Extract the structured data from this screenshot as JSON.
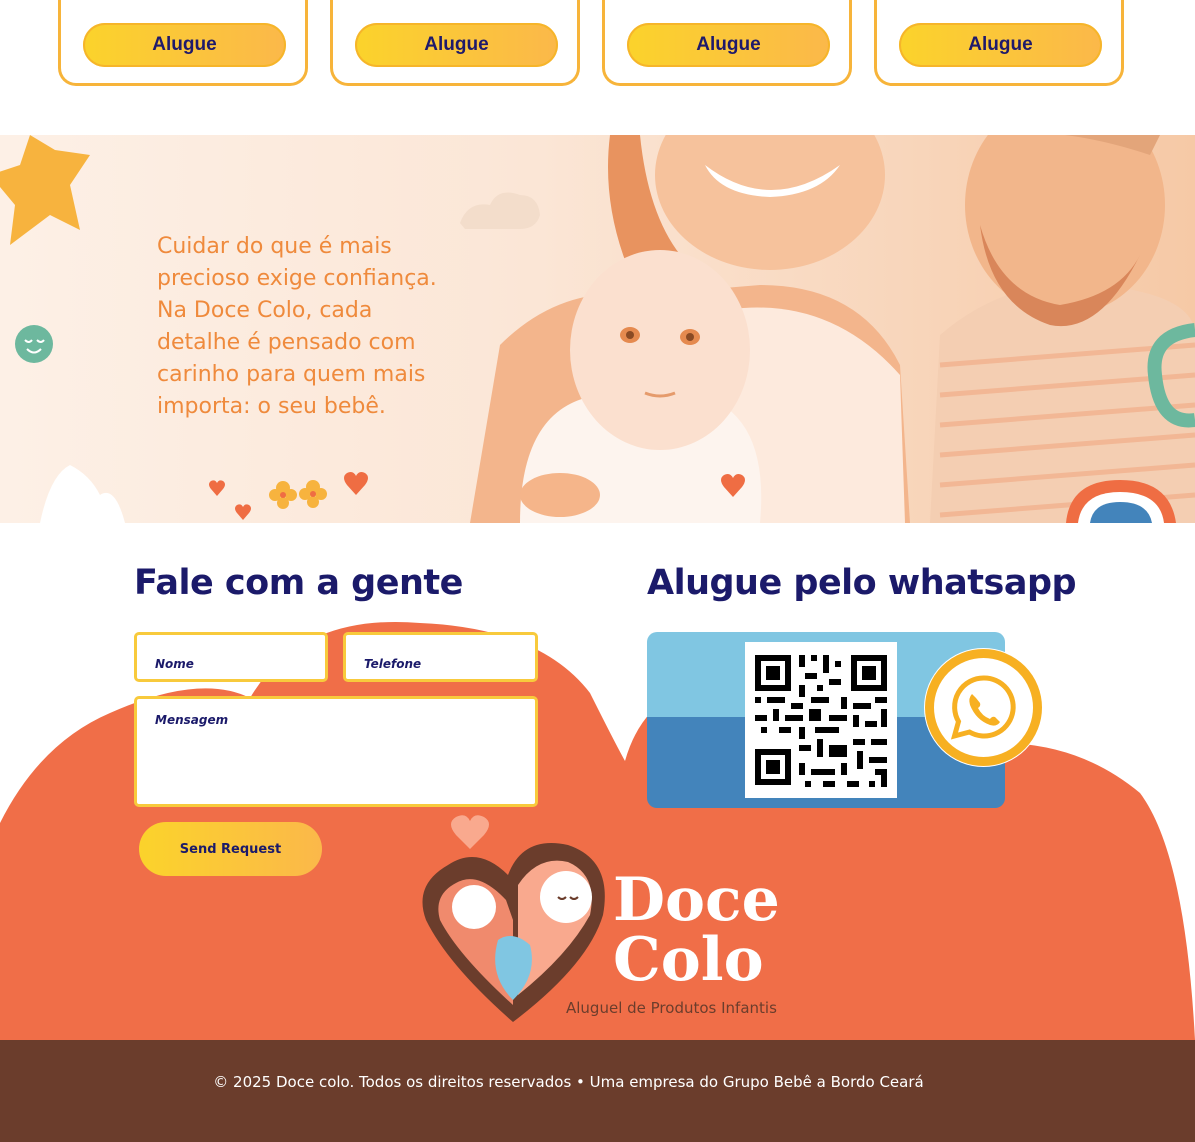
{
  "cards": [
    {
      "button": "Alugue"
    },
    {
      "button": "Alugue"
    },
    {
      "button": "Alugue"
    },
    {
      "button": "Alugue"
    }
  ],
  "hero": {
    "text": "Cuidar do que é mais precioso exige confiança. Na Doce Colo, cada detalhe é pensado com carinho para quem mais importa: o seu bebê."
  },
  "contact": {
    "title": "Fale com a gente",
    "name_placeholder": "Nome",
    "phone_placeholder": "Telefone",
    "message_placeholder": "Mensagem",
    "send_label": "Send Request"
  },
  "whatsapp": {
    "title": "Alugue pelo whatsapp",
    "icon": "whatsapp-icon"
  },
  "brand": {
    "line1": "Doce",
    "line2": "Colo",
    "tagline": "Aluguel de Produtos Infantis"
  },
  "footer": {
    "copyright": "© 2025 Doce colo. Todos os direitos reservados • Uma empresa do Grupo Bebê a Bordo Ceará"
  },
  "colors": {
    "accent_orange": "#f06e48",
    "accent_yellow": "#fbd32b",
    "navy": "#1b1a6a",
    "footer_brown": "#6b3d2c"
  }
}
